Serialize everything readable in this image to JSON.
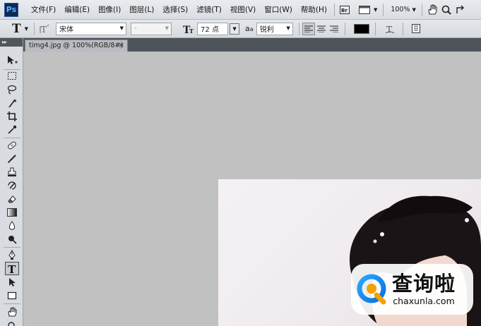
{
  "app": {
    "logo_text": "Ps"
  },
  "menu": {
    "items": [
      "文件(F)",
      "编辑(E)",
      "图像(I)",
      "图层(L)",
      "选择(S)",
      "滤镜(T)",
      "视图(V)",
      "窗口(W)",
      "帮助(H)"
    ],
    "zoom": "100%"
  },
  "options": {
    "font_family": "宋体",
    "font_style": "-",
    "font_size": "72 点",
    "aa_prefix": "a",
    "aa_prefix_small": "a",
    "antialias": "锐利",
    "text_color": "#000000"
  },
  "document": {
    "tab_title": "timg4.jpg @ 100%(RGB/8#)",
    "close_glyph": "×"
  },
  "watermark": {
    "title": "查询啦",
    "url": "chaxunla.com"
  },
  "toolbox": {
    "header": "▸▸"
  }
}
